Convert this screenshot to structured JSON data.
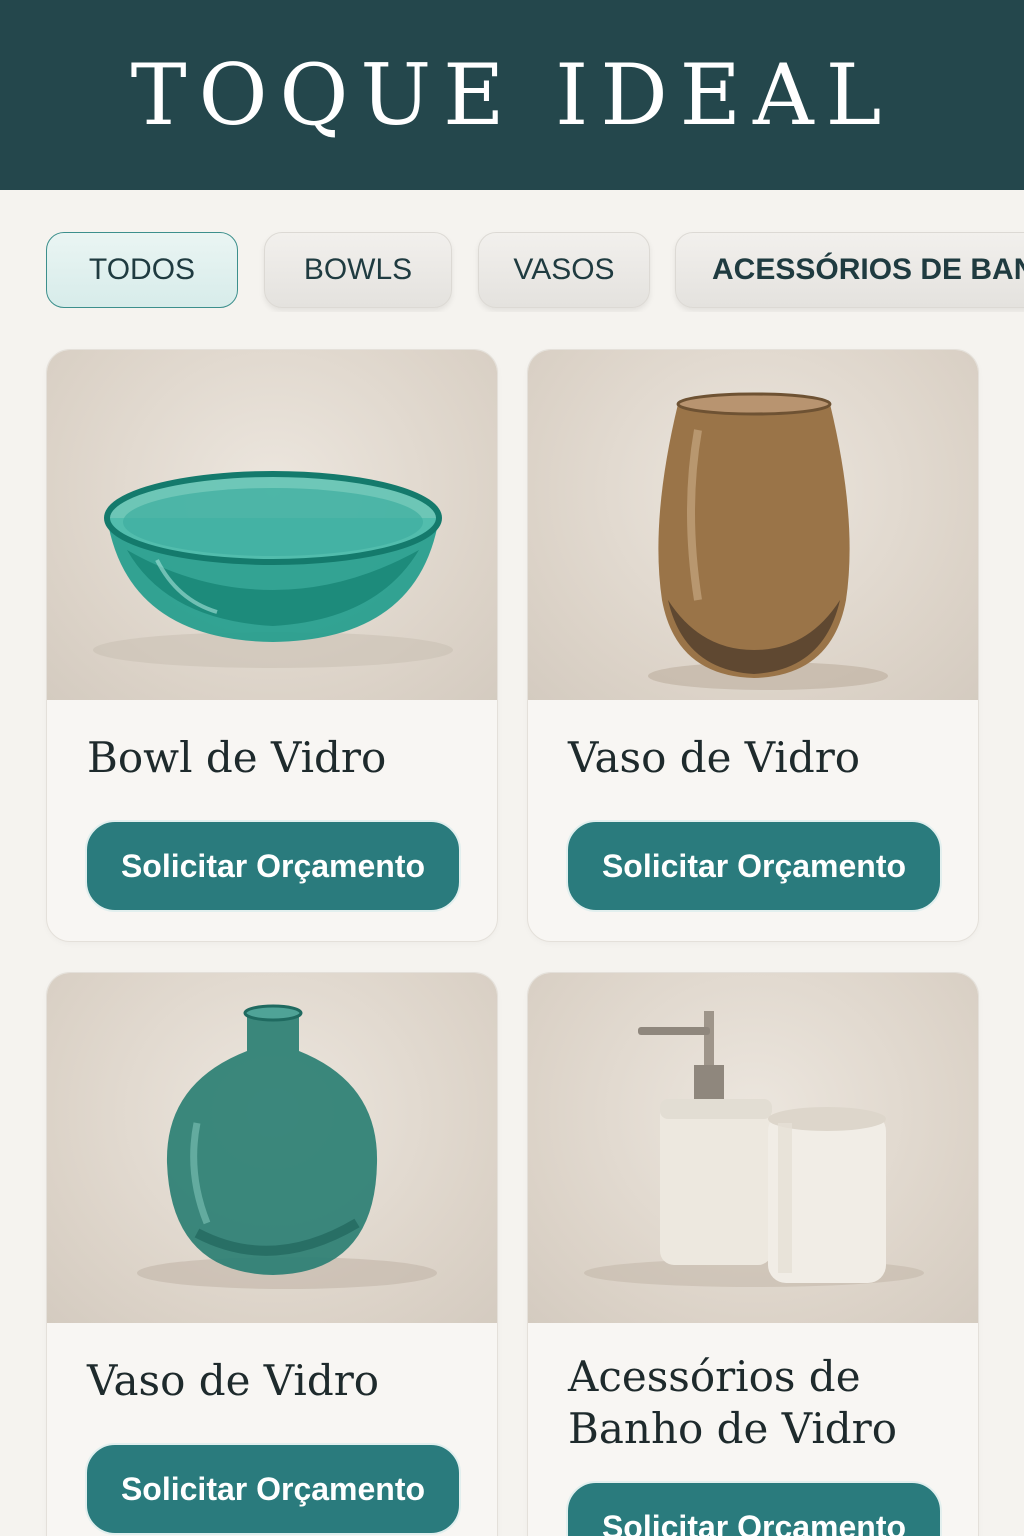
{
  "header": {
    "brand": "TOQUE IDEAL"
  },
  "filters": [
    {
      "label": "TODOS",
      "active": true
    },
    {
      "label": "BOWLS",
      "active": false
    },
    {
      "label": "VASOS",
      "active": false
    },
    {
      "label": "ACESSÓRIOS DE BAN",
      "active": false
    }
  ],
  "products": [
    {
      "title": "Bowl de Vidro",
      "cta": "Solicitar Orçamento",
      "image": "teal-glass-bowl"
    },
    {
      "title": "Vaso de Vidro",
      "cta": "Solicitar Orçamento",
      "image": "amber-glass-vase"
    },
    {
      "title": "Vaso de Vidro",
      "cta": "Solicitar Orçamento",
      "image": "teal-round-vase"
    },
    {
      "title_line1": "Acessórios de",
      "title_line2": "Banho de Vidro",
      "cta": "Solicitar Orçamento",
      "image": "bath-accessories-set"
    }
  ],
  "colors": {
    "header": "#24474c",
    "accent": "#2a7b7d",
    "background": "#f5f3ef"
  }
}
